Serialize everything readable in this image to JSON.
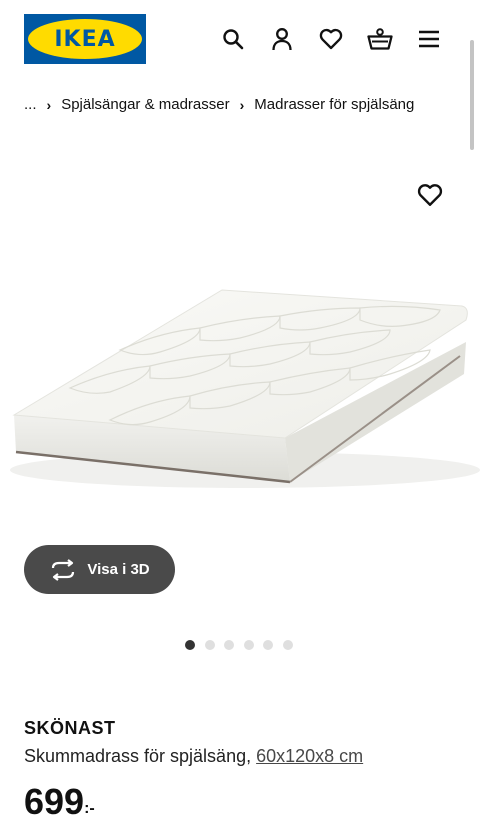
{
  "brand": {
    "logo_text": "IKEA",
    "colors": {
      "blue": "#0058a3",
      "yellow": "#ffdb00"
    }
  },
  "header": {
    "icons": [
      "search-icon",
      "user-icon",
      "heart-icon",
      "shopping-basket-icon",
      "menu-icon"
    ]
  },
  "breadcrumb": {
    "ellipsis": "...",
    "items": [
      "Spjälsängar & madrasser",
      "Madrasser för spjälsäng"
    ]
  },
  "gallery": {
    "view3d_label": "Visa i 3D",
    "dot_count": 6,
    "active_dot": 0
  },
  "product": {
    "name": "SKÖNAST",
    "description": "Skummadrass för spjälsäng,",
    "size": "60x120x8 cm",
    "price": "699",
    "price_suffix": ":-"
  }
}
